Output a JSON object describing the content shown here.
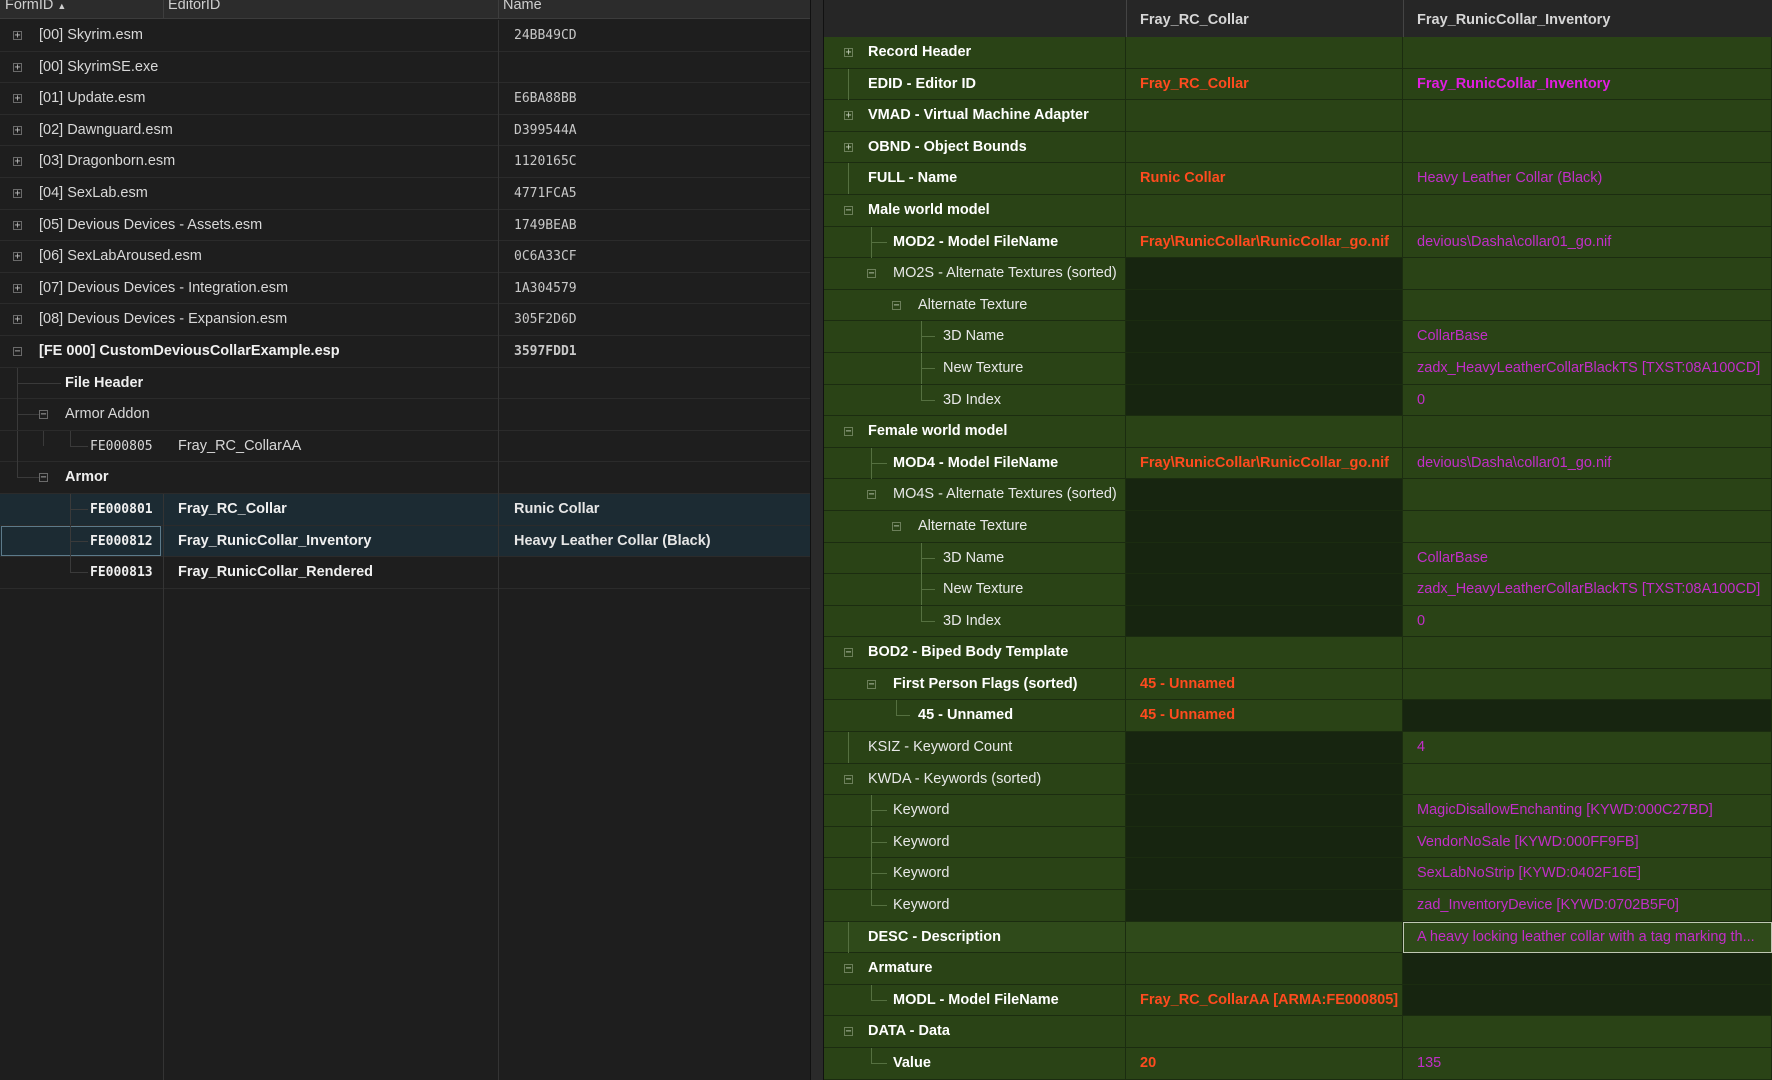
{
  "left_header": {
    "col1": "FormID",
    "col2": "EditorID",
    "col3": "Name",
    "sort_indicator": "▲"
  },
  "left_rows": [
    {
      "c1": "[00] Skyrim.esm",
      "c3": "24BB49CD"
    },
    {
      "c1": "[00] SkyrimSE.exe",
      "c3": ""
    },
    {
      "c1": "[01] Update.esm",
      "c3": "E6BA88BB"
    },
    {
      "c1": "[02] Dawnguard.esm",
      "c3": "D399544A"
    },
    {
      "c1": "[03] Dragonborn.esm",
      "c3": "1120165C"
    },
    {
      "c1": "[04] SexLab.esm",
      "c3": "4771FCA5"
    },
    {
      "c1": "[05] Devious Devices - Assets.esm",
      "c3": "1749BEAB"
    },
    {
      "c1": "[06] SexLabAroused.esm",
      "c3": "0C6A33CF"
    },
    {
      "c1": "[07] Devious Devices - Integration.esm",
      "c3": "1A304579"
    },
    {
      "c1": "[08] Devious Devices - Expansion.esm",
      "c3": "305F2D6D"
    },
    {
      "c1": "[FE 000] CustomDeviousCollarExample.esp",
      "c3": "3597FDD1"
    },
    {
      "c1": "File Header"
    },
    {
      "c1": "Armor Addon"
    },
    {
      "c1": "FE000805",
      "c2": "Fray_RC_CollarAA"
    },
    {
      "c1": "Armor"
    },
    {
      "c1": "FE000801",
      "c2": "Fray_RC_Collar",
      "c3": "Runic Collar"
    },
    {
      "c1": "FE000812",
      "c2": "Fray_RunicCollar_Inventory",
      "c3": "Heavy Leather Collar (Black)"
    },
    {
      "c1": "FE000813",
      "c2": "Fray_RunicCollar_Rendered"
    }
  ],
  "right_header": {
    "col1": "Fray_RC_Collar",
    "col2": "Fray_RunicCollar_Inventory"
  },
  "right_rows": [
    {
      "label": "Record Header",
      "v1": "",
      "v2": ""
    },
    {
      "label": "EDID - Editor ID",
      "v1": "Fray_RC_Collar",
      "v2": "Fray_RunicCollar_Inventory"
    },
    {
      "label": "VMAD - Virtual Machine Adapter",
      "v1": "",
      "v2": ""
    },
    {
      "label": "OBND - Object Bounds",
      "v1": "",
      "v2": ""
    },
    {
      "label": "FULL - Name",
      "v1": "Runic Collar",
      "v2": "Heavy Leather Collar (Black)"
    },
    {
      "label": "Male world model",
      "v1": "",
      "v2": ""
    },
    {
      "label": "MOD2 - Model FileName",
      "v1": "Fray\\RunicCollar\\RunicCollar_go.nif",
      "v2": "devious\\Dasha\\collar01_go.nif"
    },
    {
      "label": "MO2S - Alternate Textures (sorted)",
      "v1": "",
      "v2": ""
    },
    {
      "label": "Alternate Texture",
      "v1": "",
      "v2": ""
    },
    {
      "label": "3D Name",
      "v1": "",
      "v2": "CollarBase"
    },
    {
      "label": "New Texture",
      "v1": "",
      "v2": "zadx_HeavyLeatherCollarBlackTS [TXST:08A100CD]"
    },
    {
      "label": "3D Index",
      "v1": "",
      "v2": "0"
    },
    {
      "label": "Female world model",
      "v1": "",
      "v2": ""
    },
    {
      "label": "MOD4 - Model FileName",
      "v1": "Fray\\RunicCollar\\RunicCollar_go.nif",
      "v2": "devious\\Dasha\\collar01_go.nif"
    },
    {
      "label": "MO4S - Alternate Textures (sorted)",
      "v1": "",
      "v2": ""
    },
    {
      "label": "Alternate Texture",
      "v1": "",
      "v2": ""
    },
    {
      "label": "3D Name",
      "v1": "",
      "v2": "CollarBase"
    },
    {
      "label": "New Texture",
      "v1": "",
      "v2": "zadx_HeavyLeatherCollarBlackTS [TXST:08A100CD]"
    },
    {
      "label": "3D Index",
      "v1": "",
      "v2": "0"
    },
    {
      "label": "BOD2 - Biped Body Template",
      "v1": "",
      "v2": ""
    },
    {
      "label": "First Person Flags (sorted)",
      "v1": "45 - Unnamed",
      "v2": ""
    },
    {
      "label": "45 - Unnamed",
      "v1": "45 - Unnamed",
      "v2": ""
    },
    {
      "label": "KSIZ - Keyword Count",
      "v1": "",
      "v2": "4"
    },
    {
      "label": "KWDA - Keywords (sorted)",
      "v1": "",
      "v2": ""
    },
    {
      "label": "Keyword",
      "v1": "",
      "v2": "MagicDisallowEnchanting [KYWD:000C27BD]"
    },
    {
      "label": "Keyword",
      "v1": "",
      "v2": "VendorNoSale [KYWD:000FF9FB]"
    },
    {
      "label": "Keyword",
      "v1": "",
      "v2": "SexLabNoStrip [KYWD:0402F16E]"
    },
    {
      "label": "Keyword",
      "v1": "",
      "v2": "zad_InventoryDevice [KYWD:0702B5F0]"
    },
    {
      "label": "DESC - Description",
      "v1": "",
      "v2": "A heavy locking leather collar with a tag marking th..."
    },
    {
      "label": "Armature",
      "v1": "",
      "v2": ""
    },
    {
      "label": "MODL - Model FileName",
      "v1": "Fray_RC_CollarAA [ARMA:FE000805]",
      "v2": ""
    },
    {
      "label": "DATA - Data",
      "v1": "",
      "v2": ""
    },
    {
      "label": "Value",
      "v1": "20",
      "v2": "135"
    }
  ]
}
